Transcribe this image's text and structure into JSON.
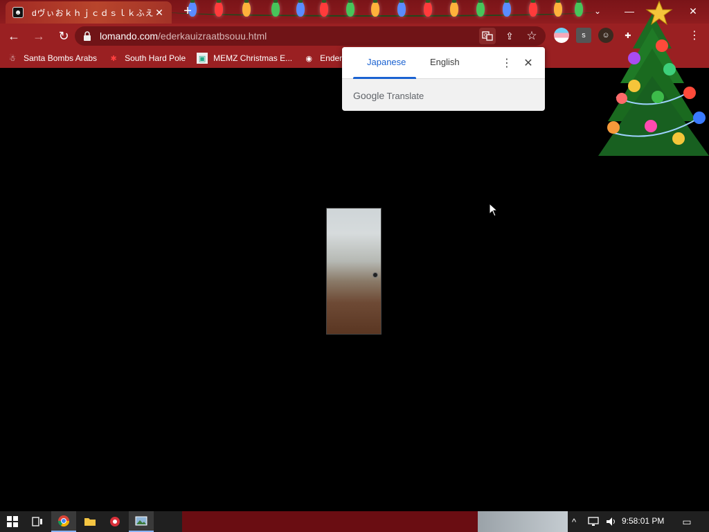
{
  "browser": {
    "tab_title": "dヴぃおｋｈｊｃｄｓｌｋふえ",
    "tab_close_glyph": "✕",
    "new_tab_glyph": "+",
    "url_host": "lomando.com",
    "url_path": "/ederkauizraatbsouu.html",
    "back_glyph": "←",
    "forward_glyph": "→",
    "reload_glyph": "↻",
    "tab_search_glyph": "⌄",
    "minimize_glyph": "—",
    "close_glyph": "✕",
    "menu_glyph": "⋮",
    "extensions_glyph": "✚",
    "bookmark_star_glyph": "☆",
    "share_glyph": "⇪"
  },
  "bookmarks": [
    {
      "label": "Santa Bombs Arabs",
      "icon": "santa-icon",
      "glyph": "☃"
    },
    {
      "label": "South Hard Pole",
      "icon": "snowflake-icon",
      "glyph": "✱"
    },
    {
      "label": "MEMZ Christmas E...",
      "icon": "memz-icon",
      "glyph": "▣"
    },
    {
      "label": "Enderm",
      "icon": "ender-icon",
      "glyph": "◉"
    }
  ],
  "translate": {
    "tabs": [
      {
        "label": "Japanese",
        "active": true
      },
      {
        "label": "English",
        "active": false
      }
    ],
    "more_glyph": "⋮",
    "close_glyph": "✕",
    "brand_google": "Google",
    "brand_translate": "Translate"
  },
  "taskbar": {
    "clock": "9:58:01 PM",
    "start_icon": "windows-start-icon",
    "tray_chevron": "^",
    "notification_glyph": "▭"
  },
  "colors": {
    "chrome_red": "#9a2022",
    "tab_accent": "#b8452c",
    "translate_blue": "#1a62d1"
  }
}
